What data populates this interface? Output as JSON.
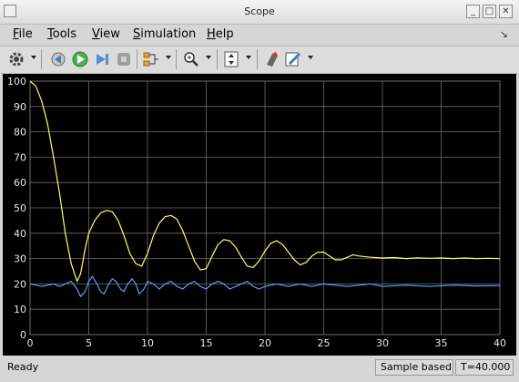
{
  "window": {
    "title": "Scope"
  },
  "menu": {
    "items": [
      {
        "label": "File",
        "underline": "F",
        "rest": "ile"
      },
      {
        "label": "Tools",
        "underline": "T",
        "rest": "ools"
      },
      {
        "label": "View",
        "underline": "V",
        "rest": "iew"
      },
      {
        "label": "Simulation",
        "underline": "S",
        "rest": "imulation"
      },
      {
        "label": "Help",
        "underline": "H",
        "rest": "elp"
      }
    ]
  },
  "toolbar": {
    "icons": [
      "gear-icon",
      "step-back-icon",
      "run-icon",
      "step-forward-icon",
      "stop-icon",
      "signal-select-icon",
      "zoom-icon",
      "autoscale-icon",
      "highlight-icon",
      "properties-icon"
    ]
  },
  "status": {
    "message": "Ready",
    "mode": "Sample based",
    "time": "T=40.000"
  },
  "colors": {
    "plot_background": "#000000",
    "grid": "#6e6e6e",
    "series_1": "#ffff66",
    "series_2": "#4da3ff",
    "tick_text": "#e6e6e6"
  },
  "chart_data": {
    "type": "line",
    "title": "",
    "xlabel": "",
    "ylabel": "",
    "xlim": [
      0,
      40
    ],
    "ylim": [
      0,
      100
    ],
    "xticks": [
      "0",
      "5",
      "10",
      "15",
      "20",
      "25",
      "30",
      "35",
      "40"
    ],
    "yticks": [
      "0",
      "10",
      "20",
      "30",
      "40",
      "50",
      "60",
      "70",
      "80",
      "90",
      "100"
    ],
    "grid": true,
    "series": [
      {
        "color": "#ffff66",
        "x": [
          0,
          0.5,
          1,
          1.5,
          2,
          2.5,
          3,
          3.5,
          4,
          4.3,
          4.7,
          5,
          5.5,
          6,
          6.5,
          7,
          7.5,
          8,
          8.5,
          9,
          9.5,
          10,
          10.5,
          11,
          11.5,
          12,
          12.5,
          13,
          13.5,
          14,
          14.5,
          15,
          15.5,
          16,
          16.5,
          17,
          17.5,
          18,
          18.5,
          19,
          19.5,
          20,
          20.5,
          21,
          21.5,
          22,
          22.5,
          23,
          23.5,
          24,
          24.5,
          25,
          25.5,
          26,
          26.5,
          27,
          27.5,
          28,
          29,
          30,
          31,
          32,
          33,
          34,
          35,
          36,
          37,
          38,
          39,
          40
        ],
        "y": [
          100,
          98,
          92,
          83,
          70,
          56,
          40,
          28,
          21,
          24,
          34,
          40,
          45,
          48,
          49,
          48.5,
          45,
          39,
          32,
          28,
          27,
          32,
          39,
          44,
          46.5,
          47,
          45.5,
          41,
          35,
          29,
          25.5,
          26,
          31,
          35.5,
          37.5,
          37,
          34.5,
          30.5,
          27,
          26.5,
          29,
          33,
          36,
          37,
          35.5,
          32.5,
          29.5,
          27.5,
          28.5,
          31,
          32.5,
          32.5,
          31,
          29.5,
          29.5,
          30.5,
          31.5,
          31,
          30.5,
          30.2,
          30.4,
          30,
          30.3,
          30.1,
          30.2,
          30,
          30.2,
          30,
          30.1,
          30
        ]
      },
      {
        "color": "#4da3ff",
        "x": [
          0,
          1,
          2,
          2.5,
          3,
          3.5,
          4,
          4.3,
          4.7,
          5,
          5.3,
          5.7,
          6,
          6.3,
          6.7,
          7,
          7.3,
          7.7,
          8,
          8.3,
          8.7,
          9,
          9.3,
          9.7,
          10,
          10.5,
          11,
          11.5,
          12,
          12.5,
          13,
          13.5,
          14,
          14.5,
          15,
          15.5,
          16,
          16.5,
          17,
          17.5,
          18,
          18.5,
          19,
          19.5,
          20,
          21,
          22,
          23,
          24,
          25,
          26,
          27,
          28,
          29,
          30,
          32,
          34,
          36,
          38,
          40
        ],
        "y": [
          20,
          19,
          20,
          19,
          20,
          21,
          18,
          15,
          17,
          21,
          23,
          20,
          17,
          16,
          20,
          22,
          21,
          18,
          17,
          20,
          22,
          20,
          16,
          18,
          21,
          20,
          18,
          20,
          21,
          19,
          18,
          20,
          21,
          19,
          18,
          20,
          21,
          20,
          18,
          19,
          20,
          21,
          19,
          18,
          19,
          20,
          19,
          20,
          19,
          20,
          19.5,
          19,
          19.5,
          20,
          19,
          19.5,
          19,
          19.5,
          19.2,
          19.3
        ]
      }
    ]
  }
}
